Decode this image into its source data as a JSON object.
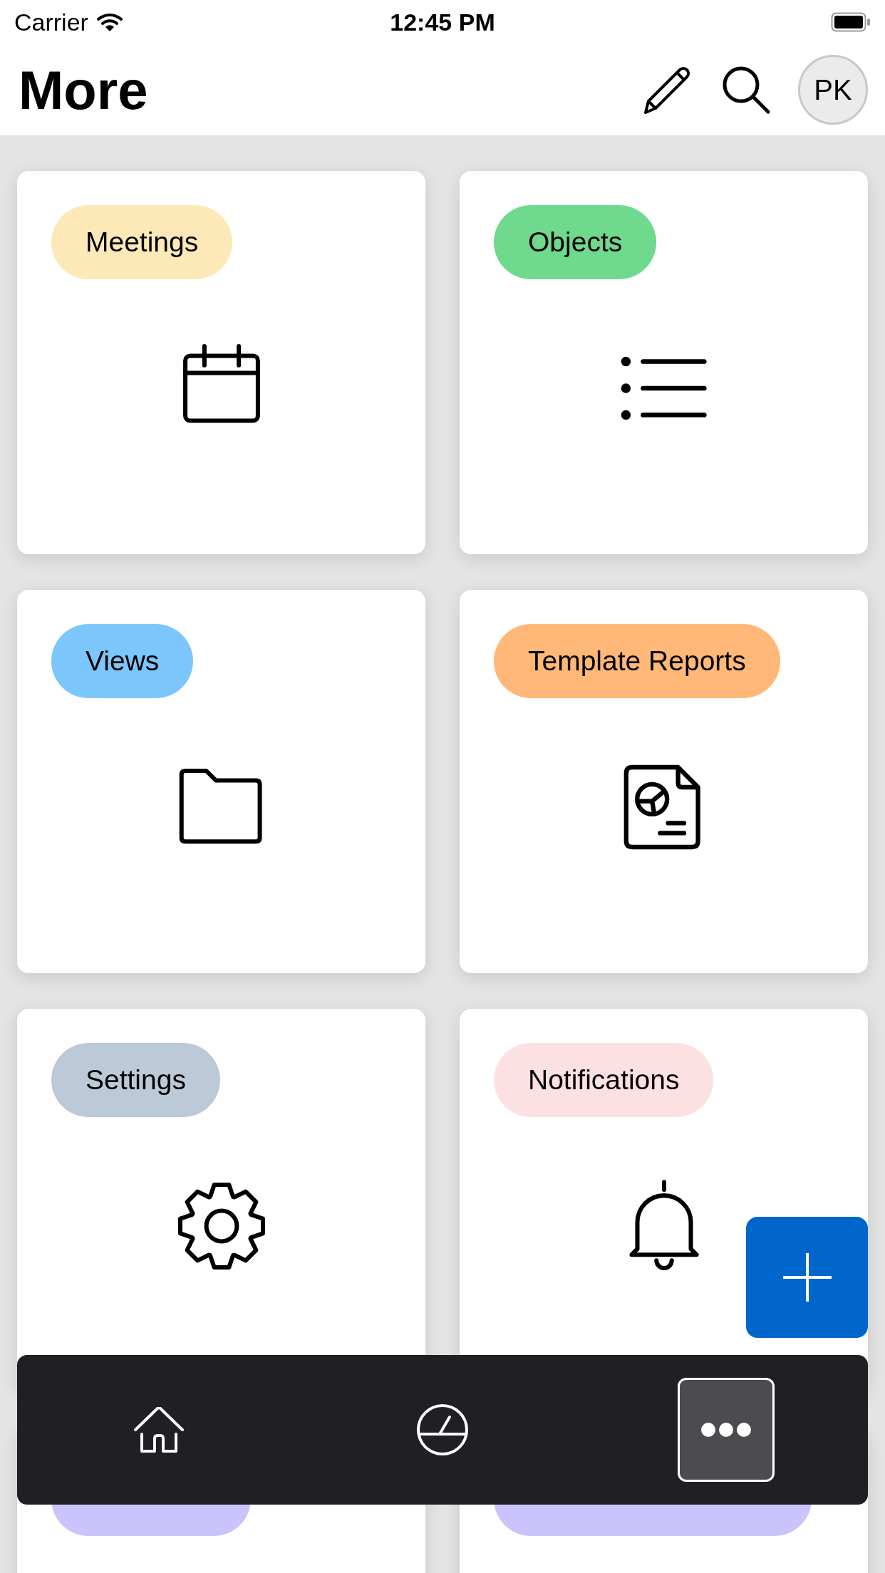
{
  "status_bar": {
    "carrier": "Carrier",
    "time": "12:45 PM"
  },
  "header": {
    "title": "More",
    "avatar": "PK"
  },
  "cards": [
    {
      "label": "Meetings",
      "color": "#fde9b8",
      "kind": "calendar"
    },
    {
      "label": "Objects",
      "color": "#6fd98e",
      "kind": "list"
    },
    {
      "label": "Views",
      "color": "#7cc6fc",
      "kind": "folder"
    },
    {
      "label": "Template Reports",
      "color": "#ffb877",
      "kind": "report"
    },
    {
      "label": "Settings",
      "color": "#bccad7",
      "kind": "gear"
    },
    {
      "label": "Notifications",
      "color": "#fde0e2",
      "kind": "bell"
    },
    {
      "color": "#cbc3fb",
      "kind": "hidden"
    },
    {
      "color": "#cbc3fb",
      "kind": "hidden"
    }
  ],
  "tab_bar": [
    {
      "kind": "home",
      "selected": false
    },
    {
      "kind": "gauge",
      "selected": false
    },
    {
      "kind": "more",
      "selected": true
    }
  ]
}
